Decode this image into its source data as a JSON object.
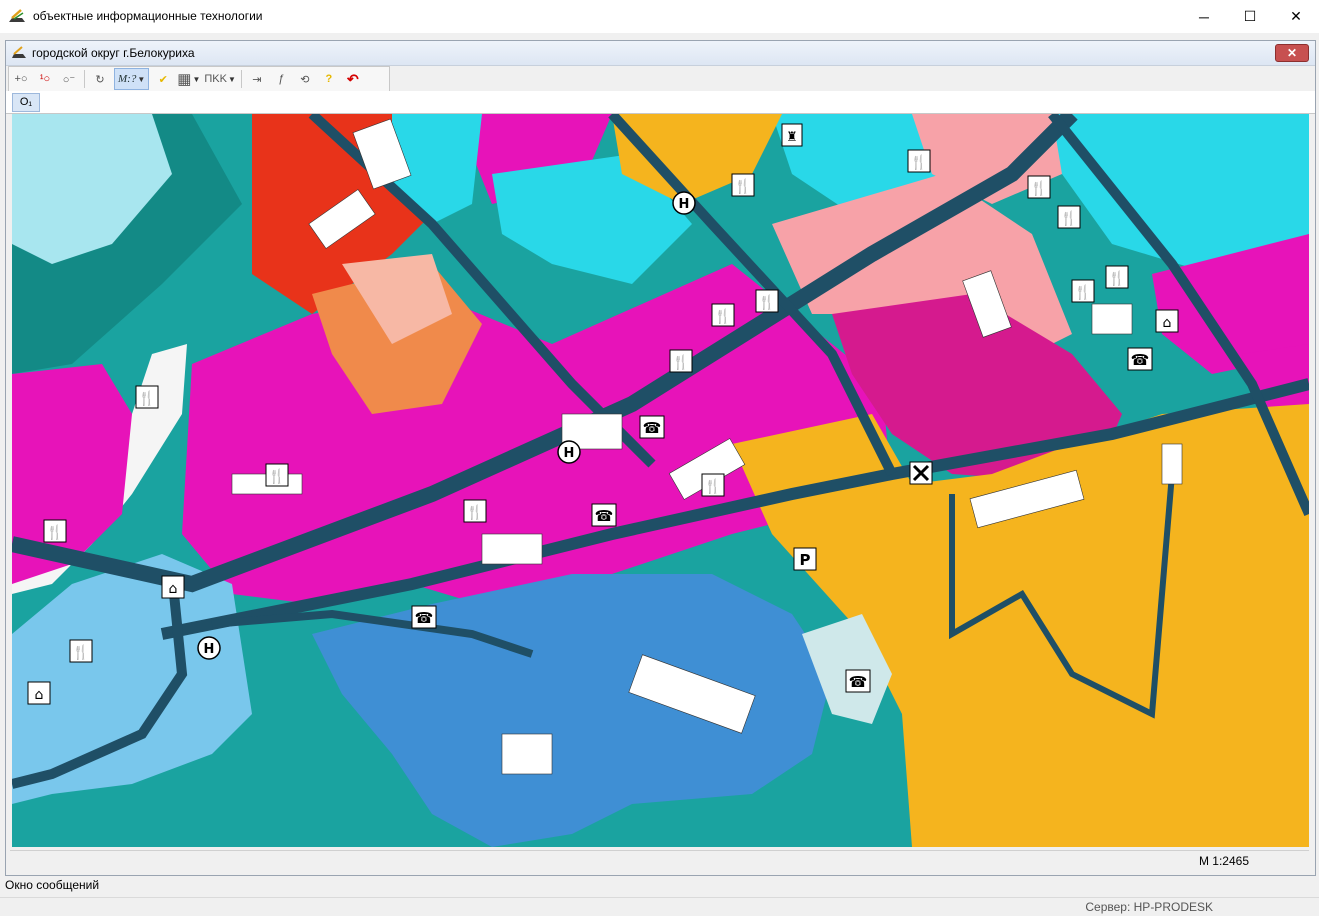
{
  "app": {
    "title": "объектные информационные технологии"
  },
  "window_controls": {
    "minimize": "─",
    "maximize": "☐",
    "close": "✕"
  },
  "document": {
    "title": "городской округ г.Белокуриха",
    "close": "✕"
  },
  "toolbar": {
    "items": [
      {
        "name": "add-point",
        "glyph": "+○"
      },
      {
        "name": "numbered-point",
        "glyph": "¹○"
      },
      {
        "name": "point-line",
        "glyph": "○⁻"
      },
      {
        "name": "refresh",
        "glyph": "↻"
      },
      {
        "name": "measure",
        "glyph": "M:?"
      },
      {
        "name": "check",
        "glyph": "✔"
      },
      {
        "name": "grid",
        "glyph": "▦"
      },
      {
        "name": "text-style",
        "glyph": "ПKK"
      },
      {
        "name": "export",
        "glyph": "⇥"
      },
      {
        "name": "function",
        "glyph": "ƒ"
      },
      {
        "name": "rotate",
        "glyph": "⟲"
      },
      {
        "name": "help",
        "glyph": "?"
      },
      {
        "name": "undo",
        "glyph": "↶"
      }
    ]
  },
  "layer_button": {
    "label": "O₁"
  },
  "map": {
    "colors": {
      "teal": "#1aa3a0",
      "magenta": "#e713b9",
      "orange": "#f5b41e",
      "cyan": "#29d8e8",
      "road": "#1f4f66",
      "pink": "#f7a2a8",
      "red": "#e8331a",
      "blue": "#3f8fd4"
    },
    "symbols": [
      {
        "type": "restaurant",
        "glyph": "🍴"
      },
      {
        "type": "phone",
        "glyph": "☎"
      },
      {
        "type": "hotel",
        "glyph": "H"
      },
      {
        "type": "parking",
        "glyph": "P"
      },
      {
        "type": "monument",
        "glyph": "♜"
      },
      {
        "type": "tram",
        "glyph": "⌂"
      }
    ]
  },
  "status": {
    "scale": "М 1:2465"
  },
  "messages": {
    "title": "Окно сообщений"
  },
  "server": {
    "label": "Сервер: HP-PRODESK"
  }
}
